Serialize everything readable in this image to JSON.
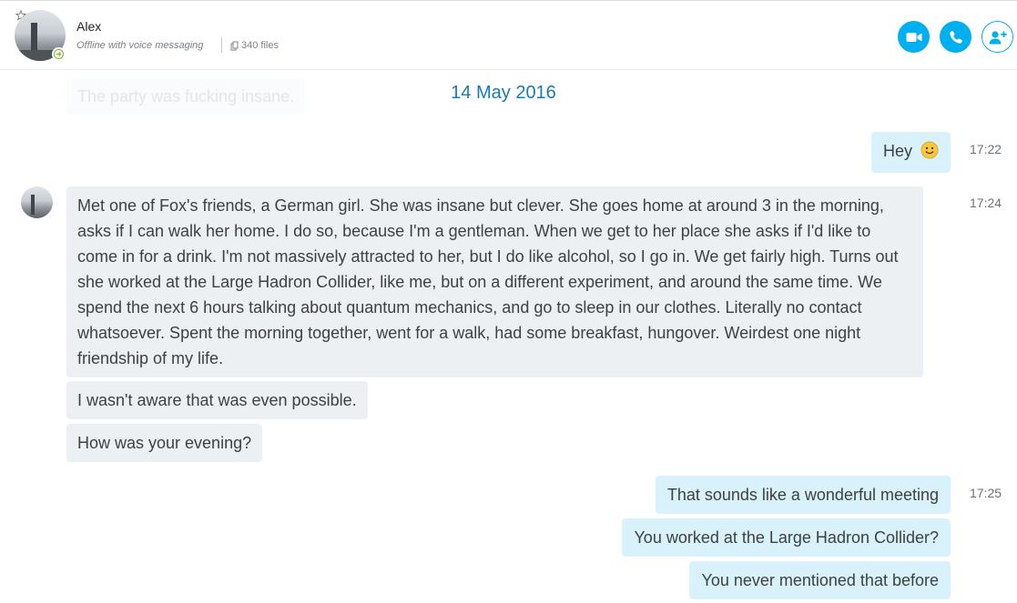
{
  "header": {
    "contact_name": "Alex",
    "status_text": "Offline with voice messaging",
    "files_count": "340 files",
    "buttons": {
      "video": "video-call",
      "call": "audio-call",
      "add": "add-participant"
    },
    "accent_color": "#00aff0"
  },
  "chat": {
    "ghost_text": "The party was fucking insane.",
    "date_separator": "14 May 2016",
    "messages": [
      {
        "direction": "out",
        "text": "Hey",
        "emoji": "smiley",
        "time": "17:22"
      },
      {
        "direction": "in",
        "text": "Met one of Fox's friends, a German girl. She was insane but clever. She goes home at around 3 in the morning, asks if I can walk her home. I do so, because I'm a gentleman. When we get to her place she asks if I'd like to come in for a drink. I'm not massively attracted to her, but I do like alcohol, so I go in. We get fairly high. Turns out she worked at the Large Hadron Collider, like me, but on a different experiment, and around the same time. We spend the next 6 hours talking about quantum mechanics, and go to sleep in our clothes. Literally no contact whatsoever. Spent the morning together, went for a walk, had some breakfast, hungover. Weirdest one night friendship of my life.",
        "time": "17:24"
      },
      {
        "direction": "in",
        "text": "I wasn't aware that was even possible."
      },
      {
        "direction": "in",
        "text": "How was your evening?"
      },
      {
        "direction": "out",
        "text": "That sounds like a wonderful meeting",
        "time": "17:25"
      },
      {
        "direction": "out",
        "text": "You worked at the Large Hadron Collider?"
      },
      {
        "direction": "out",
        "text": "You never mentioned that before"
      }
    ]
  }
}
